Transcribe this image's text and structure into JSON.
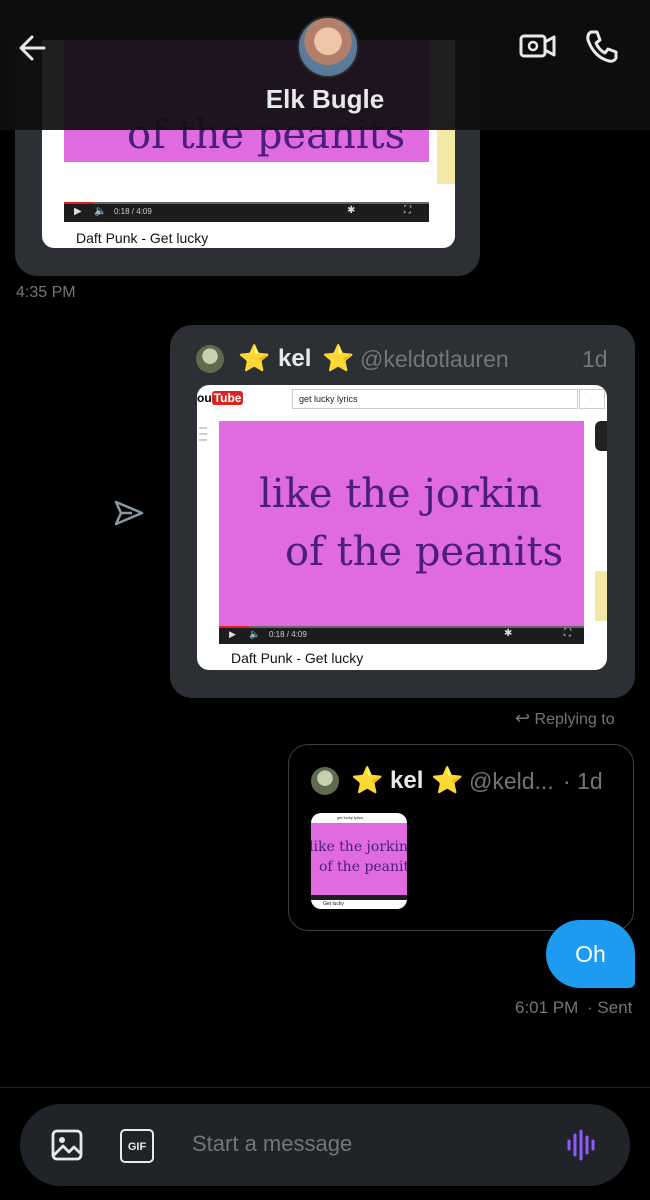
{
  "header": {
    "title": "Elk Bugle",
    "icons": {
      "back": "arrow-left-icon",
      "video": "video-camera-icon",
      "call": "phone-icon"
    }
  },
  "top_message": {
    "lyric_line2": "of the peanits",
    "video_time": "0:18 / 4:09",
    "video_caption": "Daft Punk - Get lucky",
    "timestamp": "4:35 PM"
  },
  "shared_tweet": {
    "display_name_prefix": "⭐",
    "display_name": "kel",
    "display_name_suffix": "⭐",
    "handle": "@keldotlauren",
    "age": "1d",
    "search_text": "get lucky lyrics",
    "lyric_line1": "like the jorkin",
    "lyric_line2": "of the peanits",
    "video_time": "0:18 / 4:09",
    "video_caption": "Daft Punk - Get lucky",
    "youtube_logo": "You Tube"
  },
  "reply": {
    "replying_to": "Replying to",
    "quoted": {
      "display_name_prefix": "⭐",
      "display_name": "kel",
      "display_name_suffix": "⭐",
      "handle": "@keld...",
      "age": "· 1d",
      "lyric_line1": "like the jorkin",
      "lyric_line2": "of the peanits",
      "search_text": "get lucky lyrics",
      "video_caption": "Get lucky"
    },
    "message": "Oh",
    "time": "6:01 PM",
    "status": "· Sent"
  },
  "composer": {
    "placeholder": "Start a message",
    "gif_label": "GIF",
    "icons": {
      "image": "image-icon",
      "gif": "gif-icon",
      "voice": "voice-waveform-icon",
      "share": "send-icon"
    }
  },
  "colors": {
    "accent": "#1d9bf0",
    "card": "#2c2f33",
    "pink": "#e06be1"
  }
}
